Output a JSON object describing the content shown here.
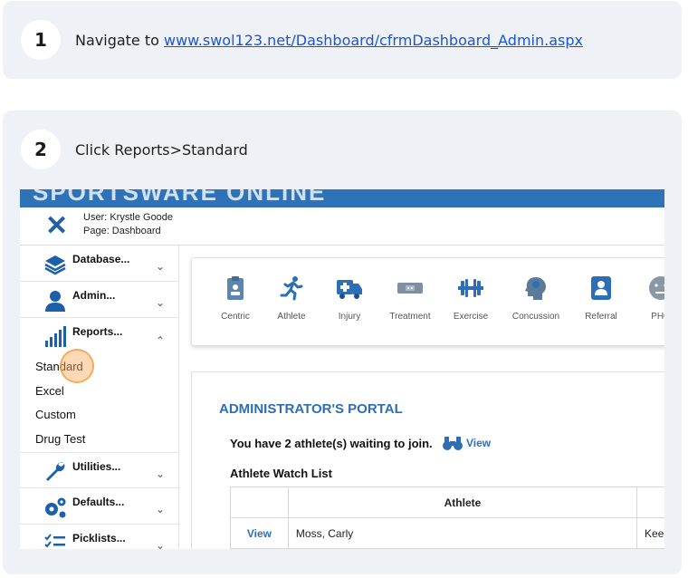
{
  "steps": [
    {
      "number": "1",
      "prefix": "Navigate to ",
      "link": "www.swol123.net/Dashboard/cfrmDashboard_Admin.aspx"
    },
    {
      "number": "2",
      "text": "Click Reports>Standard"
    }
  ],
  "screenshot": {
    "brand": "SPORTSWARE ONLINE",
    "user_line": "User:  Krystle Goode",
    "page_line": "Page:  Dashboard",
    "menus": [
      {
        "label": "Database...",
        "icon": "layers-icon",
        "chevron": "⌄"
      },
      {
        "label": "Admin...",
        "icon": "person-icon",
        "chevron": "⌄"
      },
      {
        "label": "Reports...",
        "icon": "bar-chart-icon",
        "chevron": "⌃"
      },
      {
        "label": "Utilities...",
        "icon": "wrench-icon",
        "chevron": "⌄"
      },
      {
        "label": "Defaults...",
        "icon": "gears-icon",
        "chevron": "⌄"
      },
      {
        "label": "Picklists...",
        "icon": "checklist-icon",
        "chevron": "⌄"
      }
    ],
    "report_items": [
      "Standard",
      "Excel",
      "Custom",
      "Drug Test"
    ],
    "modules": [
      {
        "label": "Centric",
        "icon": "clipboard-icon"
      },
      {
        "label": "Athlete",
        "icon": "runner-icon"
      },
      {
        "label": "Injury",
        "icon": "ambulance-icon"
      },
      {
        "label": "Treatment",
        "icon": "treatment-icon"
      },
      {
        "label": "Exercise",
        "icon": "dumbbell-icon"
      },
      {
        "label": "Concussion",
        "icon": "head-icon"
      },
      {
        "label": "Referral",
        "icon": "contact-icon"
      },
      {
        "label": "PHQ",
        "icon": "face-icon"
      }
    ],
    "portal_title": "ADMINISTRATOR'S PORTAL",
    "waiting_text": "You have 2 athlete(s) waiting to join.",
    "view_label": "View",
    "watch_list_title": "Athlete Watch List",
    "table_header": {
      "col1": "",
      "col2": "Athlete",
      "col3": ""
    },
    "table_rows": [
      {
        "action": "View",
        "athlete": "Moss, Carly",
        "extra": "Keep"
      }
    ]
  },
  "colors": {
    "accent_blue": "#2e72b8",
    "link_blue": "#1a56d6",
    "card_bg": "#eef1f6",
    "click_highlight": "#f5a65b"
  }
}
